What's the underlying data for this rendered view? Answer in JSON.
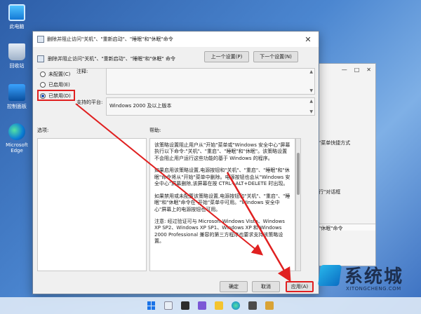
{
  "desktop": {
    "icons": [
      {
        "label": "此电脑",
        "icon": "computer-icon"
      },
      {
        "label": "回收站",
        "icon": "recycle-bin-icon"
      },
      {
        "label": "控制面板",
        "icon": "control-panel-icon"
      },
      {
        "label": "Microsoft Edge",
        "icon": "edge-icon"
      }
    ]
  },
  "background_window": {
    "controls": [
      "—",
      "□",
      "✕"
    ],
    "lines": [
      "始\"菜单快捷方式",
      "运行\"对话框",
      "和\"休眠\"命令"
    ]
  },
  "dialog": {
    "title": "删除并阻止访问\"关机\"、\"重新启动\"、\"睡眠\"和\"休眠\"命令",
    "header": "删除并阻止访问\"关机\"、\"重新启动\"、\"睡眠\"和\"休眠\" 命令",
    "prev_setting": "上一个设置(P)",
    "next_setting": "下一个设置(N)",
    "options": [
      {
        "label": "未配置(C)",
        "selected": false
      },
      {
        "label": "已启用(E)",
        "selected": false
      },
      {
        "label": "已禁用(D)",
        "selected": true
      }
    ],
    "comment_label": "注释:",
    "platform_label": "支持的平台:",
    "platform_value": "Windows 2000 及以上版本",
    "options_label": "选项:",
    "help_label": "帮助:",
    "help_paragraphs": [
      "该策略设置阻止用户从\"开始\"菜单或\"Windows 安全中心\"屏幕执行以下命令:\"关机\"、\"重启\"、\"睡眠\"和\"休眠\"。该策略设置不会阻止用户运行这些功能的基于 Windows 的程序。",
      "如果启用该策略设置,电源按钮和\"关机\"、\"重启\"、\"睡眠\"和\"休眠\"命令将从\"开始\"菜单中删除。电源按钮也会从\"Windows 安全中心\"屏幕删除,该屏幕在按 CTRL+ALT+DELETE 时出现。",
      "如果禁用或未配置该策略设置,电源按钮和\"关机\"、\"重启\"、\"睡眠\"和\"休眠\"命令在\"开始\"菜单中可用。\"Windows 安全中心\"屏幕上的电源按钮也可用。",
      "注意: 经过验证可与 Microsoft Windows Vista、Windows XP SP2、Windows XP SP1、Windows XP 和 Windows 2000 Professional 兼容的第三方程序也要求支持该策略设置。"
    ],
    "ok": "确定",
    "cancel": "取消",
    "apply": "应用(A)"
  },
  "watermark": {
    "title": "系统城",
    "url": "XITONGCHENG.COM"
  },
  "colors": {
    "highlight": "#e02020",
    "desktop": "#4b86d0"
  }
}
